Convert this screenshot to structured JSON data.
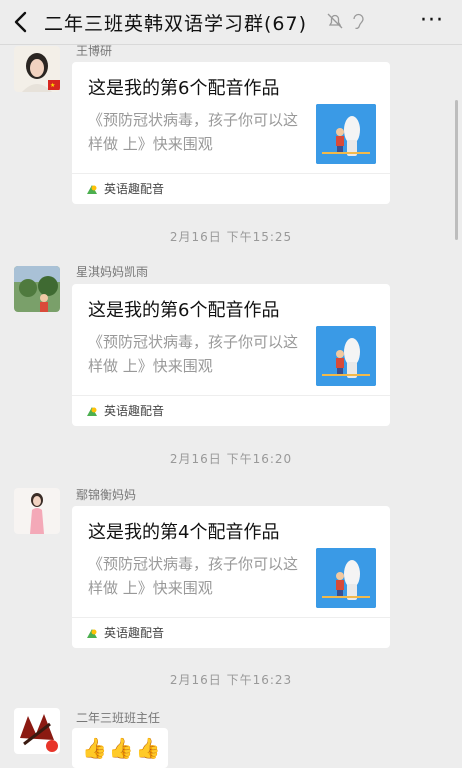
{
  "header": {
    "title": "二年三班英韩双语学习群(67)",
    "more": "···"
  },
  "messages": [
    {
      "sender": "王博研",
      "card_title": "这是我的第6个配音作品",
      "card_desc": "《预防冠状病毒，孩子你可以这样做 上》快来围观",
      "app": "英语趣配音"
    },
    {
      "sender": "星淇妈妈凯雨",
      "card_title": "这是我的第6个配音作品",
      "card_desc": "《预防冠状病毒，孩子你可以这样做 上》快来围观",
      "app": "英语趣配音"
    },
    {
      "sender": "鄢锦衡妈妈",
      "card_title": "这是我的第4个配音作品",
      "card_desc": "《预防冠状病毒，孩子你可以这样做 上》快来围观",
      "app": "英语趣配音"
    },
    {
      "sender": "二年三班班主任",
      "reply": "👍👍👍"
    }
  ],
  "timestamps": [
    "2月16日 下午15:25",
    "2月16日 下午16:20",
    "2月16日 下午16:23"
  ],
  "colors": {
    "background": "#ededed",
    "card": "#ffffff",
    "thumbnail": "#3a9ae6"
  }
}
